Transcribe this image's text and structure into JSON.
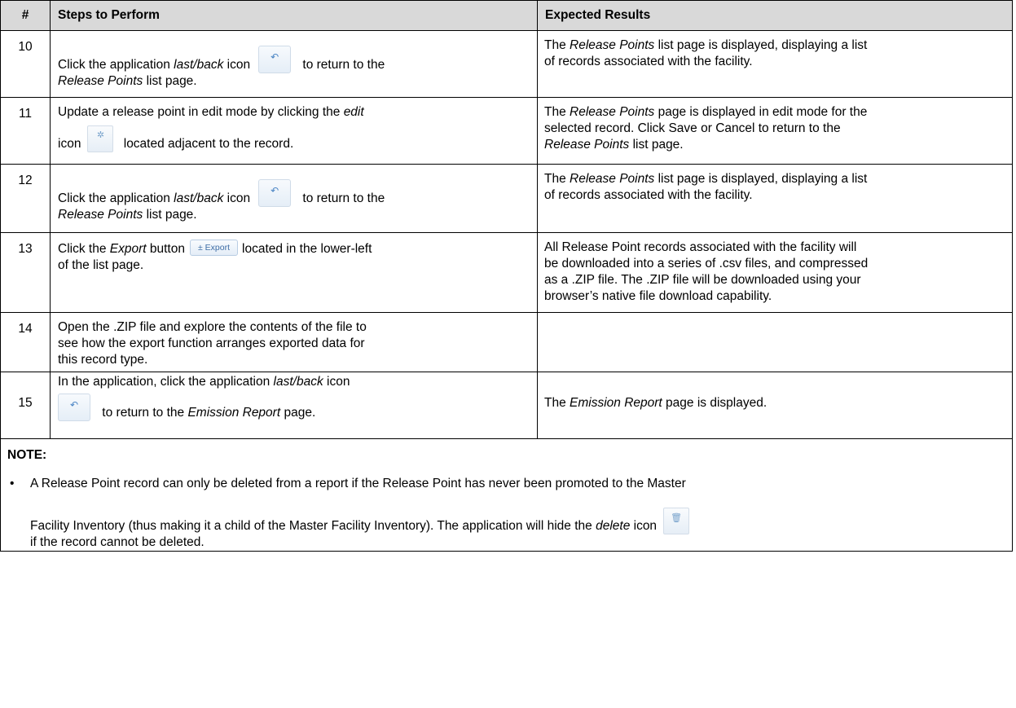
{
  "headers": {
    "num": "#",
    "steps": "Steps to Perform",
    "results": "Expected Results"
  },
  "rows": [
    {
      "num": "10",
      "steps": {
        "l1_a": "Click the application ",
        "l1_em": "last/back",
        "l1_b": " icon",
        "l1_c": " to return to the",
        "l2_em": "Release Points",
        "l2_b": " list page."
      },
      "results": {
        "l1_a": "The ",
        "l1_em": "Release Points",
        "l1_b": " list page is displayed, displaying a list",
        "l2": "of records associated with the facility."
      }
    },
    {
      "num": "11",
      "steps": {
        "l1_a": "Update a release point in edit mode by clicking the ",
        "l1_em": "edit",
        "l2_a": "icon",
        "l2_b": " located adjacent to the record."
      },
      "results": {
        "l1_a": "The ",
        "l1_em": "Release Points",
        "l1_b": " page is displayed in edit mode for the",
        "l2": "selected record. Click Save or Cancel to return to the",
        "l3_em": "Release Points",
        "l3_b": " list page."
      }
    },
    {
      "num": "12",
      "steps": {
        "l1_a": "Click the application ",
        "l1_em": "last/back",
        "l1_b": " icon",
        "l1_c": " to return to the",
        "l2_em": "Release Points",
        "l2_b": " list page."
      },
      "results": {
        "l1_a": "The ",
        "l1_em": "Release Points",
        "l1_b": " list page is displayed, displaying a list",
        "l2": "of records associated with the facility."
      }
    },
    {
      "num": "13",
      "steps": {
        "l1_a": "Click the ",
        "l1_em": "Export",
        "l1_b": " button",
        "l1_c": "located in the lower-left",
        "l2": "of the list page.",
        "export_label": "Export"
      },
      "results": {
        "l1": "All Release Point records associated with the facility will",
        "l2": "be downloaded into a series of .csv files, and compressed",
        "l3": "as a .ZIP file.  The .ZIP file will be downloaded using your",
        "l4": "browser’s native file download capability."
      }
    },
    {
      "num": "14",
      "steps": {
        "l1": "Open the .ZIP file and explore the contents of the file to",
        "l2": "see how the export function arranges exported data for",
        "l3": "this record type."
      },
      "results": {}
    },
    {
      "num": "15",
      "steps": {
        "l1_a": "In the application, click the application ",
        "l1_em": "last/back",
        "l1_b": " icon",
        "l2_a": " to return to the ",
        "l2_em": "Emission Report",
        "l2_b": " page."
      },
      "results": {
        "l1_a": "The ",
        "l1_em": "Emission Report",
        "l1_b": " page is displayed."
      }
    }
  ],
  "note": {
    "title": "NOTE:",
    "bullet": "•",
    "l1": "A Release Point record can only be deleted from a report if the Release Point has never been promoted to the Master",
    "l2_a": "Facility Inventory (thus making it a child of the Master Facility Inventory). The application will hide the ",
    "l2_em": "delete",
    "l2_b": " icon",
    "l3": "if the record cannot be deleted."
  },
  "icons": {
    "back": "back-arrow-icon",
    "edit": "gear-icon",
    "export": "download-icon",
    "delete": "trash-icon"
  },
  "colors": {
    "header_bg": "#d9d9d9",
    "icon_blue": "#4a84c4"
  }
}
